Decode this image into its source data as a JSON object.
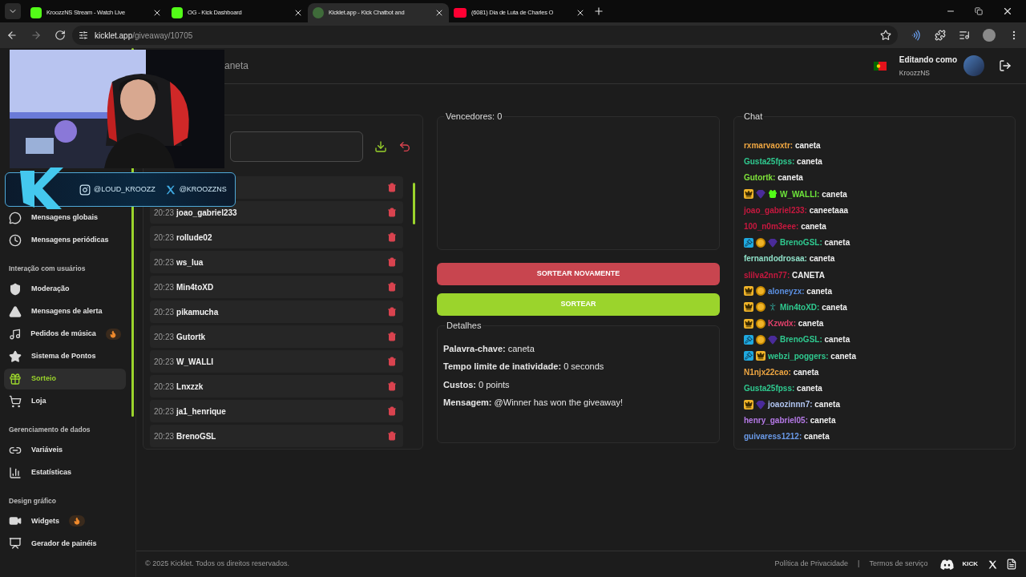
{
  "browser": {
    "tabs": [
      {
        "title": "KroozzNS Stream - Watch Live",
        "selected": false
      },
      {
        "title": "OG - Kick Dashboard",
        "selected": false
      },
      {
        "title": "Kicklet.app - Kick Chatbot and",
        "selected": true
      },
      {
        "title": "(6081) Dia de Luta de Charles O",
        "selected": false
      }
    ],
    "url_host": "kicklet.app",
    "url_path": "/giveaway/10705"
  },
  "overlay": {
    "instagram": "@LOUD_KROOZZ",
    "x": "@KROOZZNS"
  },
  "header": {
    "title": "aneta",
    "editing_label": "Editando como",
    "user": "KroozzNS"
  },
  "sidebar": [
    {
      "kind": "item",
      "label": "Mensagens globais",
      "selected": false
    },
    {
      "kind": "item",
      "label": "Mensagens periódicas",
      "selected": false
    },
    {
      "kind": "section",
      "label": "Interação com usuários"
    },
    {
      "kind": "item",
      "label": "Moderação",
      "selected": false
    },
    {
      "kind": "item",
      "label": "Mensagens de alerta",
      "selected": false
    },
    {
      "kind": "item",
      "label": "Pedidos de música",
      "selected": false,
      "hot": true
    },
    {
      "kind": "item",
      "label": "Sistema de Pontos",
      "selected": false
    },
    {
      "kind": "item",
      "label": "Sorteio",
      "selected": true
    },
    {
      "kind": "item",
      "label": "Loja",
      "selected": false
    },
    {
      "kind": "section",
      "label": "Gerenciamento de dados"
    },
    {
      "kind": "item",
      "label": "Variáveis",
      "selected": false
    },
    {
      "kind": "item",
      "label": "Estatísticas",
      "selected": false
    },
    {
      "kind": "section",
      "label": "Design gráfico"
    },
    {
      "kind": "item",
      "label": "Widgets",
      "selected": false,
      "hot": true
    },
    {
      "kind": "item",
      "label": "Gerador de painéis",
      "selected": false
    }
  ],
  "participants": [
    {
      "time": "20:23",
      "name": "joao_gabriel233"
    },
    {
      "time": "20:23",
      "name": "rollude02"
    },
    {
      "time": "20:23",
      "name": "ws_lua"
    },
    {
      "time": "20:23",
      "name": "Min4toXD"
    },
    {
      "time": "20:23",
      "name": "pikamucha"
    },
    {
      "time": "20:23",
      "name": "Gutortk"
    },
    {
      "time": "20:23",
      "name": "W_WALLI"
    },
    {
      "time": "20:23",
      "name": "Lnxzzk"
    },
    {
      "time": "20:23",
      "name": "ja1_henrique"
    },
    {
      "time": "20:23",
      "name": "BrenoGSL"
    }
  ],
  "winners": {
    "legend": "Vencedores: 0"
  },
  "buttons": {
    "redraw": "SORTEAR NOVAMENTE",
    "draw": "SORTEAR"
  },
  "details": {
    "legend": "Detalhes",
    "lines": [
      {
        "label": "Palavra-chave:",
        "value": "caneta"
      },
      {
        "label": "Tempo limite de inatividade:",
        "value": "0 seconds"
      },
      {
        "label": "Custos:",
        "value": "0 points"
      },
      {
        "label": "Mensagem:",
        "value": "@Winner has won the giveaway!"
      }
    ]
  },
  "chat": {
    "legend": "Chat",
    "messages": [
      {
        "user": "rxmarvaoxtr:",
        "color": "#f0a742",
        "text": "caneta"
      },
      {
        "user": "Gusta25fpss:",
        "color": "#2fc98f",
        "text": "caneta"
      },
      {
        "user": "Gutortk:",
        "color": "#7ee23a",
        "text": "caneta"
      },
      {
        "user": "W_WALLI:",
        "color": "#6ee63a",
        "text": "caneta"
      },
      {
        "user": "joao_gabriel233:",
        "color": "#c8183f",
        "text": "caneetaaa"
      },
      {
        "user": "100_n0m3eee:",
        "color": "#c8183f",
        "text": "caneta"
      },
      {
        "user": "BrenoGSL:",
        "color": "#2fc98f",
        "text": "caneta"
      },
      {
        "user": "fernandodrosaa:",
        "color": "#8fe0c8",
        "text": "caneta"
      },
      {
        "user": "slilva2nn77:",
        "color": "#c8183f",
        "text": "CANETA"
      },
      {
        "user": "aloneyzx:",
        "color": "#5b8fe0",
        "text": "caneta"
      },
      {
        "user": "Min4toXD:",
        "color": "#2fc98f",
        "text": "caneta"
      },
      {
        "user": "Kzwdx:",
        "color": "#e0406a",
        "text": "caneta"
      },
      {
        "user": "BrenoGSL:",
        "color": "#2fc98f",
        "text": "caneta"
      },
      {
        "user": "webzi_poggers:",
        "color": "#2fc98f",
        "text": "caneta"
      },
      {
        "user": "N1njx22cao:",
        "color": "#f0a742",
        "text": "caneta"
      },
      {
        "user": "Gusta25fpss:",
        "color": "#2fc98f",
        "text": "caneta"
      },
      {
        "user": "joaozinnn7:",
        "color": "#b0c4f0",
        "text": "caneta"
      },
      {
        "user": "henry_gabriel05:",
        "color": "#b67ae8",
        "text": "caneta"
      },
      {
        "user": "guivaress1212:",
        "color": "#6a9ae8",
        "text": "caneta"
      }
    ]
  },
  "footer": {
    "copyright": "© 2025 Kicklet. Todos os direitos reservados.",
    "links": [
      "Política de Privacidade",
      "Termos de serviço"
    ],
    "separator": "|",
    "kick_logo": "KICK"
  }
}
